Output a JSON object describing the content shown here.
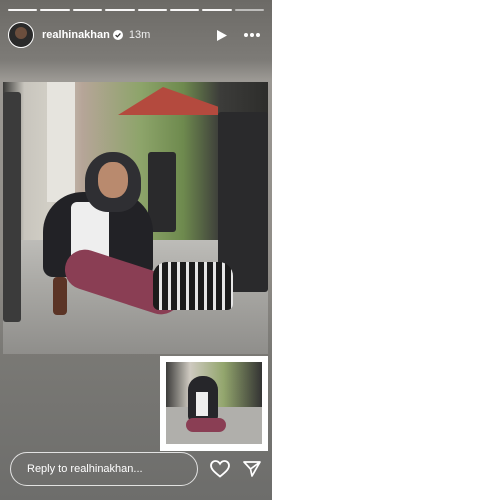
{
  "story": {
    "username": "realhinakhan",
    "time": "13m",
    "progress_total": 8,
    "progress_done": 7
  },
  "icons": {
    "verified": "verified-badge-icon",
    "play": "play-icon",
    "more": "more-options-icon",
    "like": "heart-icon",
    "share": "send-icon"
  },
  "footer": {
    "reply_placeholder": "Reply to realhinakhan..."
  },
  "colors": {
    "text": "#ffffff",
    "page_bg": "#ffffff"
  }
}
